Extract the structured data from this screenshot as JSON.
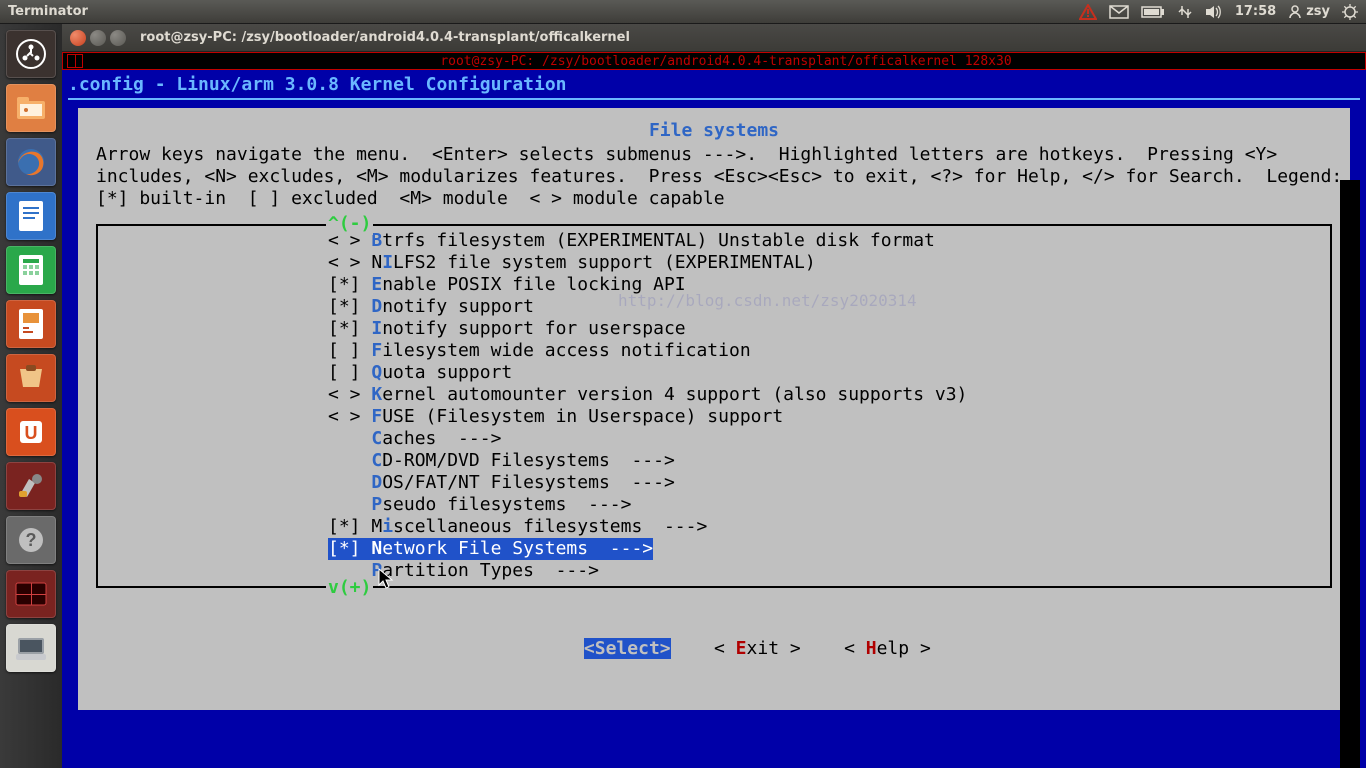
{
  "panel": {
    "app_name": "Terminator",
    "clock": "17:58",
    "user": "zsy"
  },
  "window": {
    "title": "root@zsy-PC: /zsy/bootloader/android4.0.4-transplant/officalkernel"
  },
  "splitbar": {
    "label": "root@zsy-PC: /zsy/bootloader/android4.0.4-transplant/officalkernel 128x30"
  },
  "config": {
    "title": ".config - Linux/arm 3.0.8 Kernel Configuration",
    "section": "File systems",
    "help_lines": [
      "Arrow keys navigate the menu.  <Enter> selects submenus --->.  Highlighted letters are hotkeys.  Pressing <Y>",
      "includes, <N> excludes, <M> modularizes features.  Press <Esc><Esc> to exit, <?> for Help, </> for Search.  Legend:",
      "[*] built-in  [ ] excluded  <M> module  < > module capable"
    ],
    "scroll_top": "^(-)",
    "scroll_bot": "v(+)",
    "items": [
      {
        "prefix": "< > ",
        "hk": "B",
        "rest": "trfs filesystem (EXPERIMENTAL) Unstable disk format",
        "selected": false
      },
      {
        "prefix": "< > N",
        "hk": "I",
        "rest": "LFS2 file system support (EXPERIMENTAL)",
        "selected": false
      },
      {
        "prefix": "[*] ",
        "hk": "E",
        "rest": "nable POSIX file locking API",
        "selected": false
      },
      {
        "prefix": "[*] ",
        "hk": "D",
        "rest": "notify support",
        "selected": false
      },
      {
        "prefix": "[*] ",
        "hk": "I",
        "rest": "notify support for userspace",
        "selected": false
      },
      {
        "prefix": "[ ] ",
        "hk": "F",
        "rest": "ilesystem wide access notification",
        "selected": false
      },
      {
        "prefix": "[ ] ",
        "hk": "Q",
        "rest": "uota support",
        "selected": false
      },
      {
        "prefix": "< > ",
        "hk": "K",
        "rest": "ernel automounter version 4 support (also supports v3)",
        "selected": false
      },
      {
        "prefix": "< > ",
        "hk": "F",
        "rest": "USE (Filesystem in Userspace) support",
        "selected": false
      },
      {
        "prefix": "    ",
        "hk": "C",
        "rest": "aches  --->",
        "selected": false
      },
      {
        "prefix": "    ",
        "hk": "C",
        "rest": "D-ROM/DVD Filesystems  --->",
        "selected": false
      },
      {
        "prefix": "    ",
        "hk": "D",
        "rest": "OS/FAT/NT Filesystems  --->",
        "selected": false
      },
      {
        "prefix": "    ",
        "hk": "P",
        "rest": "seudo filesystems  --->",
        "selected": false
      },
      {
        "prefix": "[*] M",
        "hk": "i",
        "rest": "scellaneous filesystems  --->",
        "selected": false
      },
      {
        "prefix": "[*] ",
        "hk": "N",
        "rest": "etwork File Systems  --->",
        "selected": true
      },
      {
        "prefix": "    ",
        "hk": "P",
        "rest": "artition Types  --->",
        "selected": false
      }
    ],
    "buttons": {
      "select": "<Select>",
      "exit_pre": "< ",
      "exit_hk": "E",
      "exit_post": "xit >",
      "help_pre": "< ",
      "help_hk": "H",
      "help_post": "elp >"
    }
  },
  "watermark": "http://blog.csdn.net/zsy2020314",
  "launcher_colors": {
    "dash": "#3b322f",
    "files": "#e07f42",
    "firefox": "#405a8a",
    "writer": "#2f72c9",
    "calc": "#2aa84a",
    "impress": "#c64a20",
    "software": "#c64a20",
    "ubuntuone": "#d94f1e",
    "settings": "#7a2320",
    "help": "#6a6a6a",
    "term": "#7a2320",
    "device": "#d8d8d2"
  }
}
